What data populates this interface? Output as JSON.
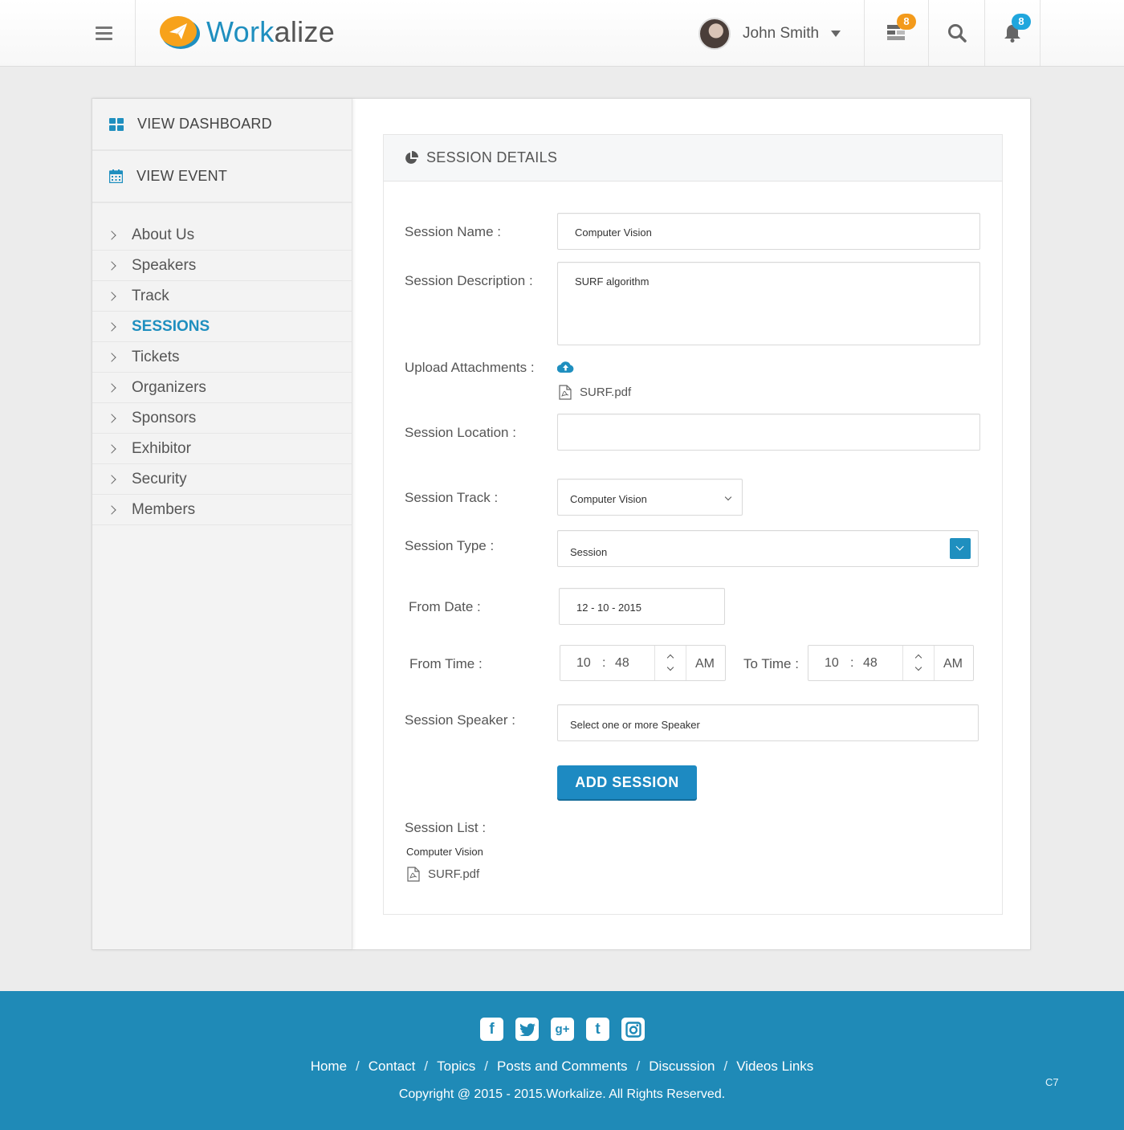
{
  "header": {
    "logo_part1": "Work",
    "logo_part2": "alize",
    "user_name": "John Smith",
    "tasks_badge": "8",
    "notifications_badge": "8",
    "colors": {
      "brand": "#1f8fbf",
      "orange_badge": "#f39a1b",
      "blue_badge": "#1fa6dd"
    }
  },
  "sidebar": {
    "dashboard_label": "VIEW DASHBOARD",
    "event_label": "VIEW EVENT",
    "items": [
      {
        "label": "About Us"
      },
      {
        "label": "Speakers"
      },
      {
        "label": "Track"
      },
      {
        "label": "SESSIONS",
        "active": true
      },
      {
        "label": "Tickets"
      },
      {
        "label": "Organizers"
      },
      {
        "label": "Sponsors"
      },
      {
        "label": "Exhibitor"
      },
      {
        "label": "Security"
      },
      {
        "label": "Members"
      }
    ]
  },
  "panel": {
    "title": "SESSION DETAILS",
    "fields": {
      "session_name": {
        "label": "Session Name :",
        "value": "Computer Vision"
      },
      "session_description": {
        "label": "Session Description :",
        "value": "SURF algorithm"
      },
      "upload": {
        "label": "Upload Attachments :",
        "file": "SURF.pdf"
      },
      "session_location": {
        "label": "Session Location :",
        "value": ""
      },
      "session_track": {
        "label": "Session Track :",
        "value": "Computer Vision"
      },
      "session_type": {
        "label": "Session Type :",
        "value": "Session"
      },
      "from_date": {
        "label": "From Date :",
        "value": "12 - 10 - 2015"
      },
      "from_time": {
        "label": "From Time :",
        "hour": "10",
        "minute": "48",
        "ampm": "AM"
      },
      "to_time": {
        "label": "To Time :",
        "hour": "10",
        "minute": "48",
        "ampm": "AM"
      },
      "session_speaker": {
        "label": "Session Speaker :",
        "placeholder": "Select one or more Speaker"
      }
    },
    "add_button": "ADD SESSION",
    "session_list": {
      "label": "Session List :",
      "items": [
        {
          "title": "Computer Vision",
          "file": "SURF.pdf"
        }
      ]
    }
  },
  "footer": {
    "socials": [
      "facebook-icon",
      "twitter-icon",
      "google-plus-icon",
      "tumblr-icon",
      "instagram-icon"
    ],
    "links": [
      "Home",
      "Contact",
      "Topics",
      "Posts and Comments",
      "Discussion",
      "Videos Links"
    ],
    "copyright": "Copyright @ 2015 - 2015.Workalize. All Rights Reserved.",
    "page_code": "C7"
  }
}
